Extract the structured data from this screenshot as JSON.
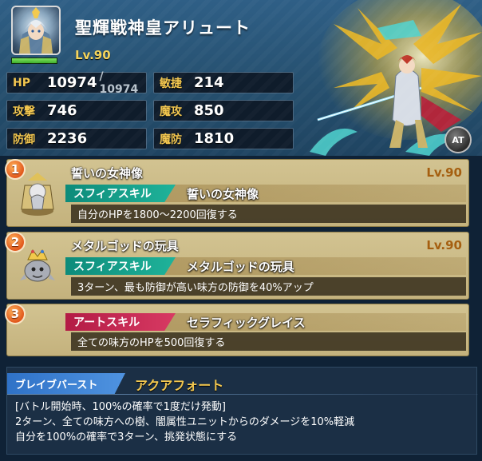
{
  "unit": {
    "name": "聖輝戦神皇アリュート",
    "level": "Lv.90",
    "portrait": "unit-portrait-icon",
    "hp_ratio": 1.0
  },
  "stats": {
    "hp": {
      "label": "HP",
      "value": "10974",
      "max": "/ 10974"
    },
    "agility": {
      "label": "敏捷",
      "value": "214"
    },
    "attack": {
      "label": "攻撃",
      "value": "746"
    },
    "magic_attack": {
      "label": "魔攻",
      "value": "850"
    },
    "defense": {
      "label": "防御",
      "value": "2236"
    },
    "magic_defense": {
      "label": "魔防",
      "value": "1810"
    }
  },
  "at_badge": "AT",
  "skills": [
    {
      "number": "1",
      "title": "誓いの女神像",
      "level": "Lv.90",
      "type_label": "スフィアスキル",
      "type_name": "誓いの女神像",
      "description": "自分のHPを1800〜2200回復する",
      "icon": "goddess-statue-sphere-icon"
    },
    {
      "number": "2",
      "title": "メタルゴッドの玩具",
      "level": "Lv.90",
      "type_label": "スフィアスキル",
      "type_name": "メタルゴッドの玩具",
      "description": "3ターン、最も防御が高い味方の防御を40%アップ",
      "icon": "metal-god-toy-sphere-icon"
    },
    {
      "number": "3",
      "title": "",
      "level": "",
      "type_label": "アートスキル",
      "type_name": "セラフィックグレイス",
      "description": "全ての味方のHPを500回復する",
      "icon": ""
    }
  ],
  "brave_burst": {
    "label": "ブレイブバースト",
    "name": "アクアフォート",
    "lines": [
      "[バトル開始時、100%の確率で1度だけ発動]",
      "2ターン、全ての味方への樹、闇属性ユニットからのダメージを10%軽減",
      "自分を100%の確率で3ターン、挑発状態にする"
    ]
  },
  "colors": {
    "stat_label": "#f3c74f",
    "level_text": "#f4d45a",
    "sphere_tag": "#1fb39a",
    "art_tag": "#d83a63",
    "brave_burst_tag": "#4f93e0"
  }
}
